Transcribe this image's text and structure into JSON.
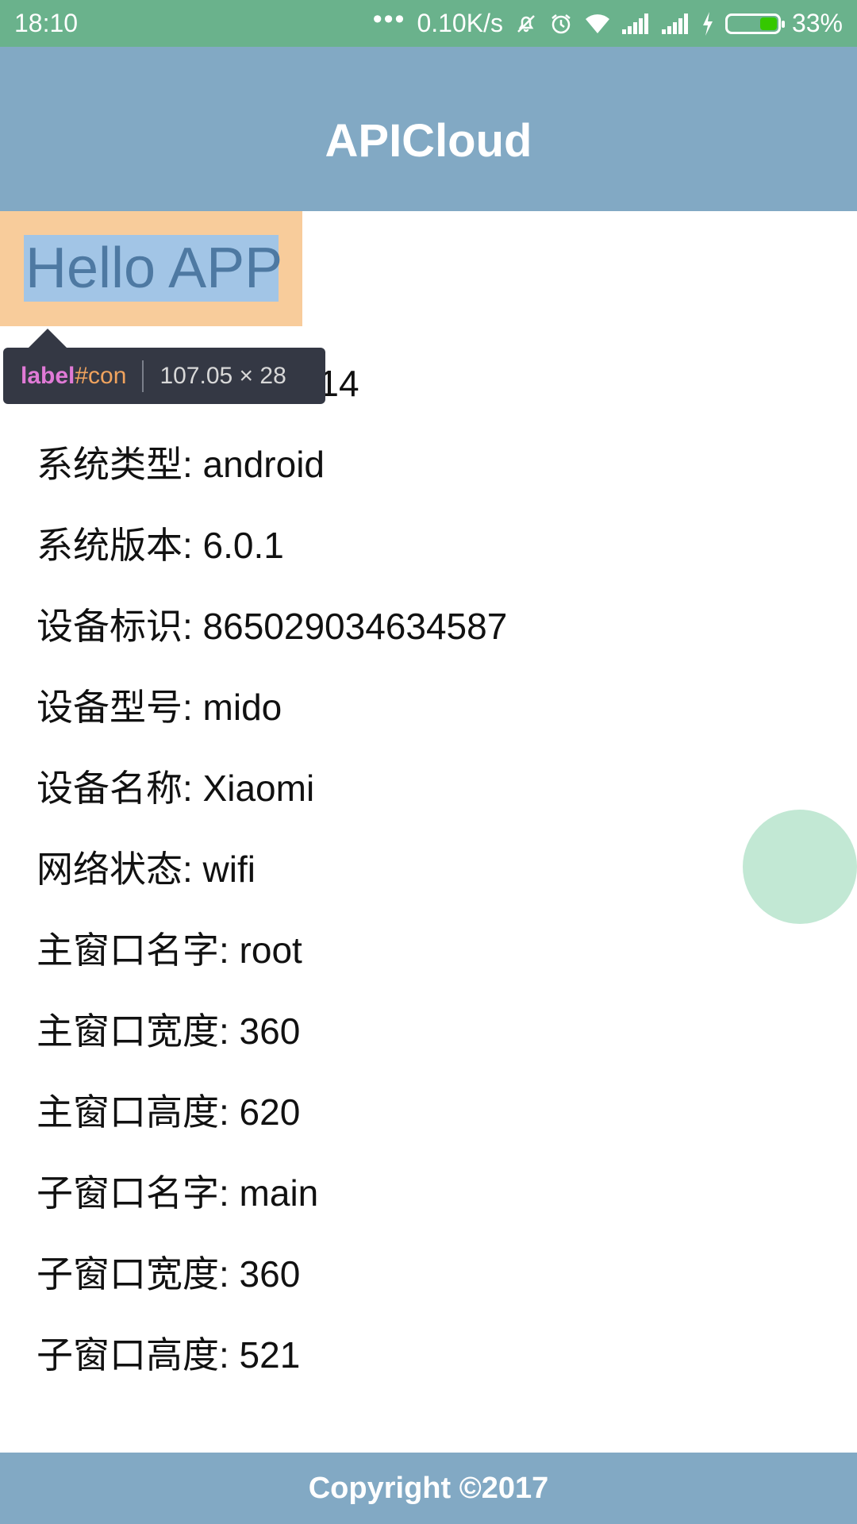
{
  "status_bar": {
    "time": "18:10",
    "net_speed": "0.10K/s",
    "battery_pct": "33%",
    "battery_level": 0.33,
    "icons": [
      "more-dots-icon",
      "mute-bell-icon",
      "alarm-icon",
      "wifi-icon",
      "signal-icon",
      "signal-icon-2",
      "charging-icon",
      "battery-icon"
    ]
  },
  "header": {
    "title": "APICloud"
  },
  "hello": {
    "label": "Hello APP"
  },
  "inspector": {
    "tag": "label",
    "id": "#con",
    "size": "107.05 × 28"
  },
  "info_rows": [
    "2.14",
    "系统类型: android",
    "系统版本: 6.0.1",
    "设备标识: 865029034634587",
    "设备型号: mido",
    "设备名称: Xiaomi",
    "网络状态: wifi",
    "主窗口名字: root",
    "主窗口宽度: 360",
    "主窗口高度: 620",
    "子窗口名字: main",
    "子窗口宽度: 360",
    "子窗口高度: 521"
  ],
  "footer": {
    "copyright": "Copyright ©2017"
  },
  "colors": {
    "status_bar": "#6ab28c",
    "header": "#82a9c4",
    "highlight_margin": "#f8cc9b",
    "highlight_content": "#a2c5e6",
    "fab": "#c2e8d4"
  }
}
